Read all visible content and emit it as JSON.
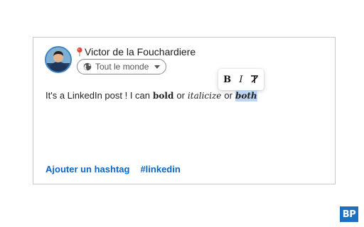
{
  "author": {
    "name": "Victor de la Fouchardiere",
    "pin_icon": "pin-icon"
  },
  "visibility": {
    "label": "Tout le monde",
    "icon": "globe-icon"
  },
  "format_toolbar": {
    "bold_label": "B",
    "italic_label": "I",
    "clear_label": "T"
  },
  "post": {
    "part1": "It's a LinkedIn post ! I can",
    "bold_word": "bold",
    "or1": "or",
    "italic_word": "italicize",
    "or2": "or",
    "both_word": "both"
  },
  "hashtags": {
    "add_label": "Ajouter un hashtag",
    "tag1": "#linkedin"
  },
  "brand": {
    "logo_text": "BP",
    "accent": "#0a66c2",
    "selection": "#bcd3f2"
  }
}
